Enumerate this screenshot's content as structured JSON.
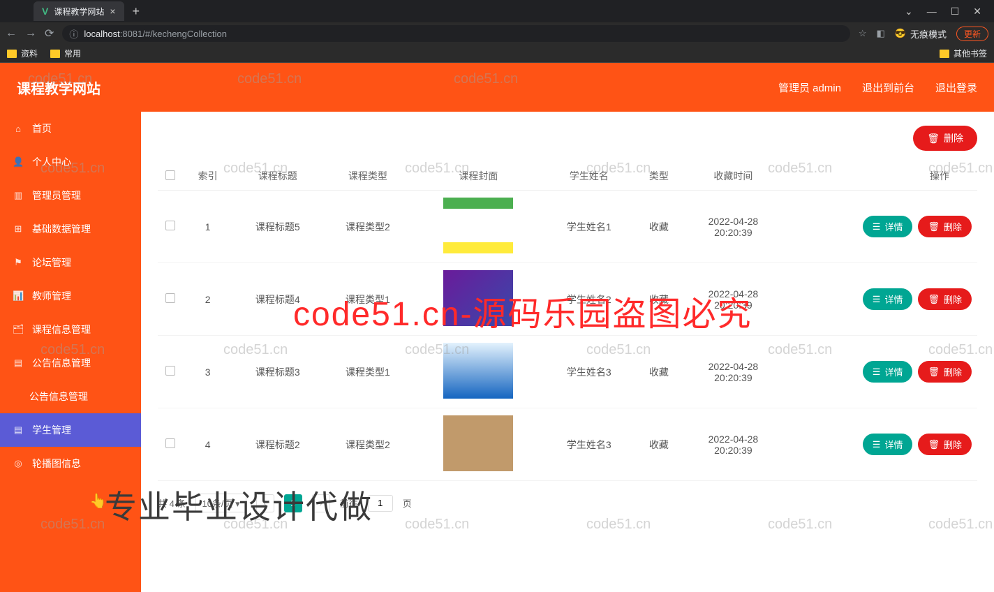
{
  "browser": {
    "tab_title": "课程教学网站",
    "tab_close": "×",
    "tab_add": "+",
    "win_dropdown": "⌄",
    "win_min": "—",
    "win_max": "☐",
    "win_close": "✕",
    "nav_back": "←",
    "nav_forward": "→",
    "nav_reload": "⟳",
    "url_icon": "ⓘ",
    "url_host": "localhost",
    "url_port": ":8081",
    "url_path": "/#/kechengCollection",
    "star": "☆",
    "ext": "◧",
    "incognito_icon": "😎",
    "incognito_label": "无痕模式",
    "update_label": "更新",
    "bookmarks": [
      {
        "label": "资料"
      },
      {
        "label": "常用"
      }
    ],
    "bookmark_other": "其他书签"
  },
  "header": {
    "title": "课程教学网站",
    "user": "管理员 admin",
    "to_front": "退出到前台",
    "logout": "退出登录"
  },
  "sidebar": {
    "items": [
      {
        "icon": "⌂",
        "label": "首页"
      },
      {
        "icon": "👤",
        "label": "个人中心"
      },
      {
        "icon": "▥",
        "label": "管理员管理"
      },
      {
        "icon": "⊞",
        "label": "基础数据管理"
      },
      {
        "icon": "⚑",
        "label": "论坛管理"
      },
      {
        "icon": "📊",
        "label": "教师管理"
      },
      {
        "icon": "🗂",
        "label": "课程信息管理"
      },
      {
        "icon": "▤",
        "label": "公告信息管理"
      },
      {
        "icon": "",
        "label": "公告信息管理",
        "sub": true
      },
      {
        "icon": "▤",
        "label": "学生管理",
        "active": true
      },
      {
        "icon": "◎",
        "label": "轮播图信息"
      }
    ]
  },
  "toolbar": {
    "delete_icon": "🗑",
    "delete_label": "删除"
  },
  "table": {
    "headers": [
      "索引",
      "课程标题",
      "课程类型",
      "课程封面",
      "学生姓名",
      "类型",
      "收藏时间",
      "操作"
    ],
    "rows": [
      {
        "idx": "1",
        "title": "课程标题5",
        "type": "课程类型2",
        "student": "学生姓名1",
        "cat": "收藏",
        "time": "2022-04-28 20:20:39"
      },
      {
        "idx": "2",
        "title": "课程标题4",
        "type": "课程类型1",
        "student": "学生姓名2",
        "cat": "收藏",
        "time": "2022-04-28 20:20:39"
      },
      {
        "idx": "3",
        "title": "课程标题3",
        "type": "课程类型1",
        "student": "学生姓名3",
        "cat": "收藏",
        "time": "2022-04-28 20:20:39"
      },
      {
        "idx": "4",
        "title": "课程标题2",
        "type": "课程类型2",
        "student": "学生姓名3",
        "cat": "收藏",
        "time": "2022-04-28 20:20:39"
      }
    ],
    "detail_icon": "☰",
    "detail_label": "详情",
    "delete_icon": "🗑",
    "delete_label": "删除"
  },
  "pagination": {
    "total": "共 4 条",
    "per_page": "10条/页",
    "prev": "‹",
    "page": "1",
    "next": "›",
    "goto_pre": "前往",
    "goto_val": "1",
    "goto_post": "页"
  },
  "watermark": {
    "text": "code51.cn",
    "big": "code51.cn-源码乐园盗图必究",
    "big2": "专业毕业设计代做"
  }
}
